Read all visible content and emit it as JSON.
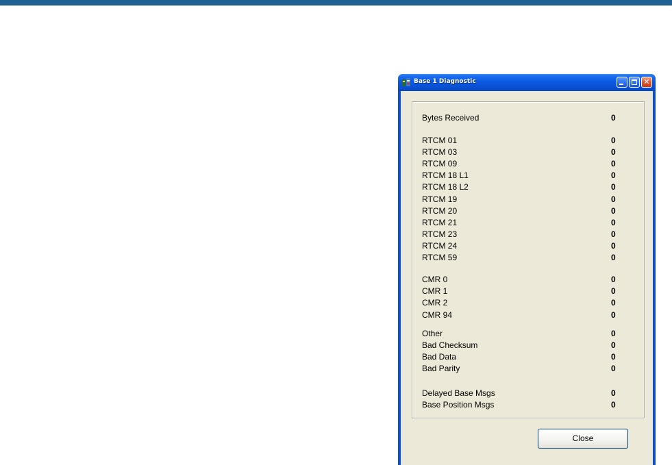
{
  "window": {
    "title": "Base 1 Diagnostic",
    "icon": "app-icon",
    "controls": {
      "minimize": "minimize-icon",
      "maximize": "maximize-icon",
      "close": "close-icon",
      "close_glyph": "✕"
    }
  },
  "diagnostics": [
    {
      "label": "Bytes Received",
      "value": "0"
    },
    {
      "label": "RTCM 01",
      "value": "0"
    },
    {
      "label": "RTCM 03",
      "value": "0"
    },
    {
      "label": "RTCM 09",
      "value": "0"
    },
    {
      "label": "RTCM 18 L1",
      "value": "0"
    },
    {
      "label": "RTCM 18 L2",
      "value": "0"
    },
    {
      "label": "RTCM 19",
      "value": "0"
    },
    {
      "label": "RTCM 20",
      "value": "0"
    },
    {
      "label": "RTCM 21",
      "value": "0"
    },
    {
      "label": "RTCM 23",
      "value": "0"
    },
    {
      "label": "RTCM 24",
      "value": "0"
    },
    {
      "label": "RTCM 59",
      "value": "0"
    },
    {
      "label": "CMR 0",
      "value": "0"
    },
    {
      "label": "CMR 1",
      "value": "0"
    },
    {
      "label": "CMR 2",
      "value": "0"
    },
    {
      "label": "CMR 94",
      "value": "0"
    },
    {
      "label": "Other",
      "value": "0"
    },
    {
      "label": "Bad Checksum",
      "value": "0"
    },
    {
      "label": "Bad Data",
      "value": "0"
    },
    {
      "label": "Bad Parity",
      "value": "0"
    },
    {
      "label": "Delayed Base Msgs",
      "value": "0"
    },
    {
      "label": "Base Position Msgs",
      "value": "0"
    }
  ],
  "buttons": {
    "close_label": "Close"
  },
  "colors": {
    "title_bar": "#0a4fd6",
    "dialog_background": "#ece9d8",
    "top_band": "#1f5f92"
  }
}
